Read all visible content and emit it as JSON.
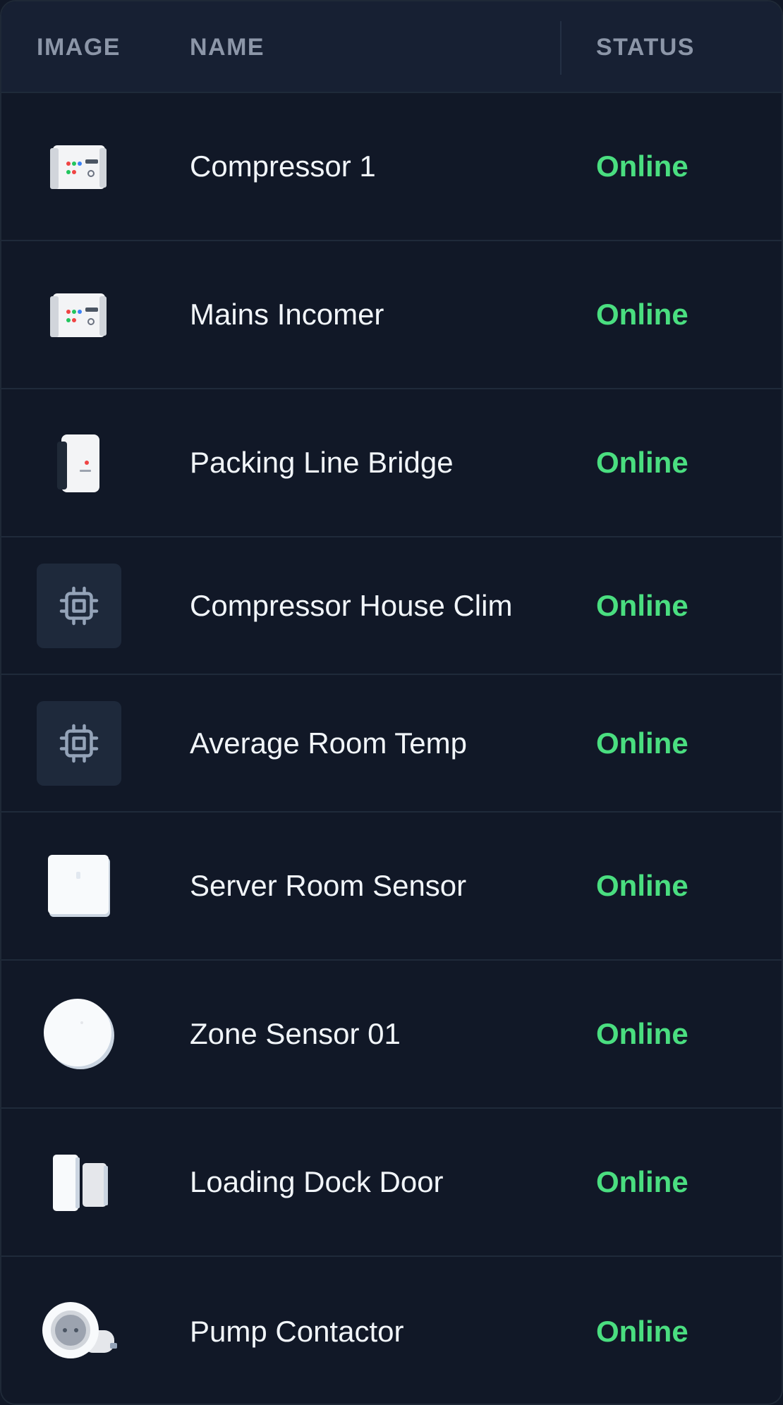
{
  "table": {
    "headers": {
      "image": "IMAGE",
      "name": "NAME",
      "status": "STATUS"
    },
    "rows": [
      {
        "name": "Compressor 1",
        "status": "Online",
        "image_icon": "energy-meter-icon"
      },
      {
        "name": "Mains Incomer",
        "status": "Online",
        "image_icon": "energy-meter-icon"
      },
      {
        "name": "Packing Line Bridge",
        "status": "Online",
        "image_icon": "bridge-device-icon"
      },
      {
        "name": "Compressor House Clim",
        "status": "Online",
        "image_icon": "chip-icon"
      },
      {
        "name": "Average Room Temp",
        "status": "Online",
        "image_icon": "chip-icon"
      },
      {
        "name": "Server Room Sensor",
        "status": "Online",
        "image_icon": "square-sensor-icon"
      },
      {
        "name": "Zone Sensor 01",
        "status": "Online",
        "image_icon": "round-sensor-icon"
      },
      {
        "name": "Loading Dock Door",
        "status": "Online",
        "image_icon": "door-sensor-icon"
      },
      {
        "name": "Pump Contactor",
        "status": "Online",
        "image_icon": "smart-plug-icon"
      }
    ]
  },
  "colors": {
    "background": "#111827",
    "header_bg": "#172033",
    "status_online": "#4ade80",
    "header_text": "#8c96a8",
    "row_text": "#f1f5f9"
  }
}
